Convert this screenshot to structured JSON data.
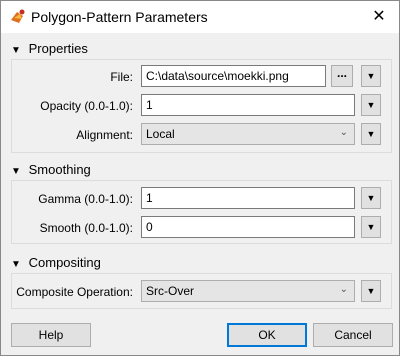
{
  "window": {
    "title": "Polygon-Pattern Parameters",
    "close_label": "✕"
  },
  "sections": {
    "properties": "Properties",
    "smoothing": "Smoothing",
    "compositing": "Compositing"
  },
  "fields": {
    "file": {
      "label": "File:",
      "value": "C:\\data\\source\\moekki.png",
      "browse": "..."
    },
    "opacity": {
      "label": "Opacity (0.0-1.0):",
      "value": "1"
    },
    "alignment": {
      "label": "Alignment:",
      "value": "Local"
    },
    "gamma": {
      "label": "Gamma (0.0-1.0):",
      "value": "1"
    },
    "smooth": {
      "label": "Smooth (0.0-1.0):",
      "value": "0"
    },
    "composite": {
      "label": "Composite Operation:",
      "value": "Src-Over"
    }
  },
  "buttons": {
    "help": "Help",
    "ok": "OK",
    "cancel": "Cancel"
  },
  "icons": {
    "collapse": "chevron-down-icon",
    "menu": "triangle-down-icon",
    "dropdown": "chevron-down-icon"
  },
  "colors": {
    "accent": "#0078d7"
  }
}
